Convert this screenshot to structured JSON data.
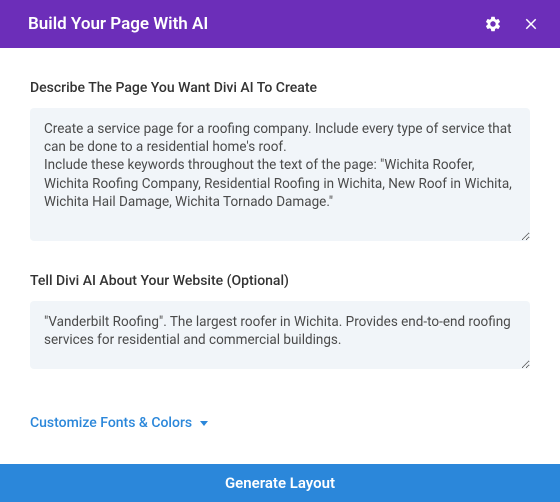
{
  "header": {
    "title": "Build Your Page With AI"
  },
  "form": {
    "describe_label": "Describe The Page You Want Divi AI To Create",
    "describe_value": "Create a service page for a roofing company. Include every type of service that can be done to a residential home's roof.\nInclude these keywords throughout the text of the page: \"Wichita Roofer, Wichita Roofing Company, Residential Roofing in Wichita, New Roof in Wichita, Wichita Hail Damage, Wichita Tornado Damage.\"",
    "about_label": "Tell Divi AI About Your Website (Optional)",
    "about_value": "\"Vanderbilt Roofing\". The largest roofer in Wichita. Provides end-to-end roofing services for residential and commercial buildings.",
    "customize_label": "Customize Fonts & Colors",
    "generate_label": "Generate Layout"
  },
  "colors": {
    "header_bg": "#6c2eb9",
    "primary_blue": "#2b87da",
    "input_bg": "#f1f5f9"
  }
}
